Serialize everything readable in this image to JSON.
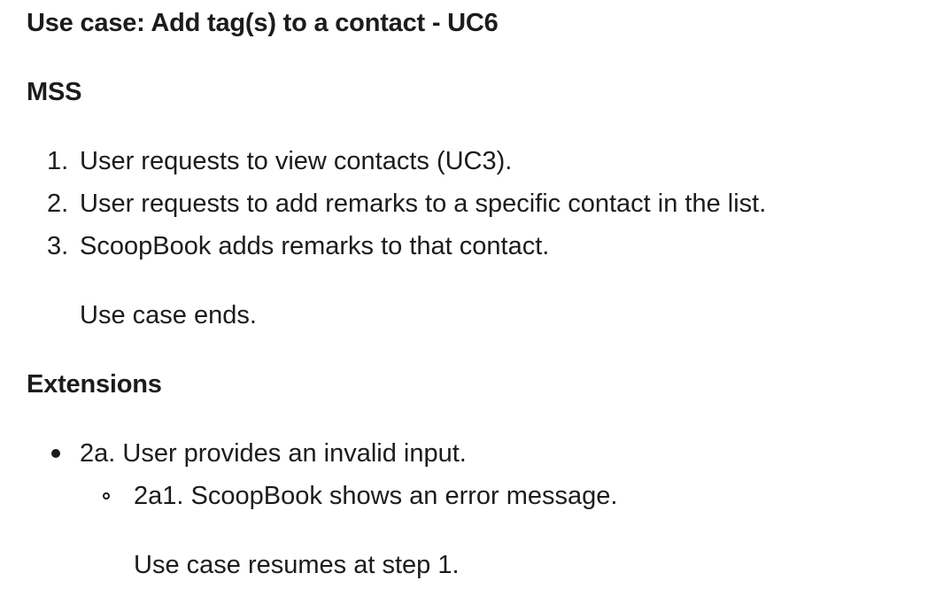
{
  "title": "Use case: Add tag(s) to a contact - UC6",
  "mss": {
    "heading": "MSS",
    "steps": [
      {
        "number": "1.",
        "text": "User requests to view contacts (UC3)."
      },
      {
        "number": "2.",
        "text": "User requests to add remarks to a specific contact in the list."
      },
      {
        "number": "3.",
        "text": "ScoopBook adds remarks to that contact."
      }
    ],
    "ending": "Use case ends."
  },
  "extensions": {
    "heading": "Extensions",
    "items": [
      {
        "text": "2a. User provides an invalid input.",
        "sub_items": [
          {
            "text": "2a1. ScoopBook shows an error message."
          }
        ],
        "ending": "Use case resumes at step 1."
      }
    ]
  }
}
